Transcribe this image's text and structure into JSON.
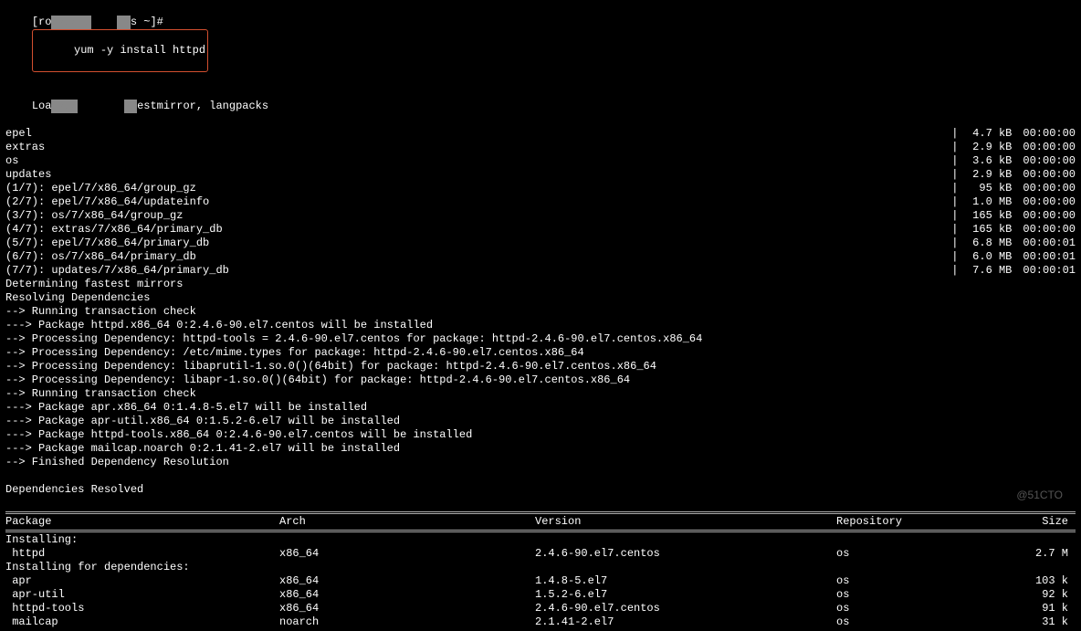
{
  "prompt": {
    "pre": "[ro",
    "mid": "s ~]#",
    "command": "yum -y install httpd",
    "line2_pre": "Loa",
    "line2_post": "estmirror, langpacks"
  },
  "repos": [
    "epel",
    "extras",
    "os",
    "updates"
  ],
  "downloads": [
    {
      "name": "epel",
      "size": "4.7 kB",
      "time": "00:00:00"
    },
    {
      "name": "extras",
      "size": "2.9 kB",
      "time": "00:00:00"
    },
    {
      "name": "os",
      "size": "3.6 kB",
      "time": "00:00:00"
    },
    {
      "name": "updates",
      "size": "2.9 kB",
      "time": "00:00:00"
    },
    {
      "name": "(1/7): epel/7/x86_64/group_gz",
      "size": "95 kB",
      "time": "00:00:00"
    },
    {
      "name": "(2/7): epel/7/x86_64/updateinfo",
      "size": "1.0 MB",
      "time": "00:00:00"
    },
    {
      "name": "(3/7): os/7/x86_64/group_gz",
      "size": "165 kB",
      "time": "00:00:00"
    },
    {
      "name": "(4/7): extras/7/x86_64/primary_db",
      "size": "165 kB",
      "time": "00:00:00"
    },
    {
      "name": "(5/7): epel/7/x86_64/primary_db",
      "size": "6.8 MB",
      "time": "00:00:01"
    },
    {
      "name": "(6/7): os/7/x86_64/primary_db",
      "size": "6.0 MB",
      "time": "00:00:01"
    },
    {
      "name": "(7/7): updates/7/x86_64/primary_db",
      "size": "7.6 MB",
      "time": "00:00:01"
    }
  ],
  "resolve": [
    "Determining fastest mirrors",
    "Resolving Dependencies",
    "--> Running transaction check",
    "---> Package httpd.x86_64 0:2.4.6-90.el7.centos will be installed",
    "--> Processing Dependency: httpd-tools = 2.4.6-90.el7.centos for package: httpd-2.4.6-90.el7.centos.x86_64",
    "--> Processing Dependency: /etc/mime.types for package: httpd-2.4.6-90.el7.centos.x86_64",
    "--> Processing Dependency: libaprutil-1.so.0()(64bit) for package: httpd-2.4.6-90.el7.centos.x86_64",
    "--> Processing Dependency: libapr-1.so.0()(64bit) for package: httpd-2.4.6-90.el7.centos.x86_64",
    "--> Running transaction check",
    "---> Package apr.x86_64 0:1.4.8-5.el7 will be installed",
    "---> Package apr-util.x86_64 0:1.5.2-6.el7 will be installed",
    "---> Package httpd-tools.x86_64 0:2.4.6-90.el7.centos will be installed",
    "---> Package mailcap.noarch 0:2.1.41-2.el7 will be installed",
    "--> Finished Dependency Resolution",
    "",
    "Dependencies Resolved",
    ""
  ],
  "table": {
    "headers": {
      "pkg": "Package",
      "arch": "Arch",
      "ver": "Version",
      "repo": "Repository",
      "size": "Size"
    },
    "groups": [
      {
        "title": "Installing:",
        "rows": [
          {
            "pkg": " httpd",
            "arch": "x86_64",
            "ver": "2.4.6-90.el7.centos",
            "repo": "os",
            "size": "2.7 M"
          }
        ]
      },
      {
        "title": "Installing for dependencies:",
        "rows": [
          {
            "pkg": " apr",
            "arch": "x86_64",
            "ver": "1.4.8-5.el7",
            "repo": "os",
            "size": "103 k"
          },
          {
            "pkg": " apr-util",
            "arch": "x86_64",
            "ver": "1.5.2-6.el7",
            "repo": "os",
            "size": "92 k"
          },
          {
            "pkg": " httpd-tools",
            "arch": "x86_64",
            "ver": "2.4.6-90.el7.centos",
            "repo": "os",
            "size": "91 k"
          },
          {
            "pkg": " mailcap",
            "arch": "noarch",
            "ver": "2.1.41-2.el7",
            "repo": "os",
            "size": "31 k"
          }
        ]
      }
    ]
  },
  "watermark": "@51CTO"
}
